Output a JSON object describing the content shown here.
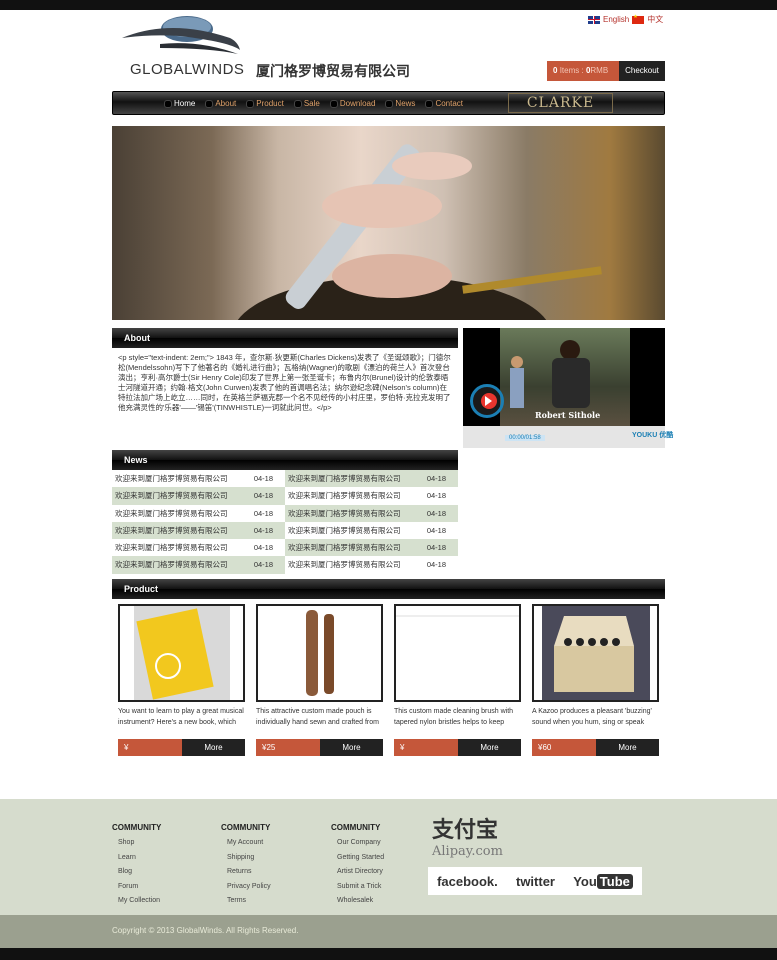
{
  "header": {
    "lang_en": "English",
    "lang_zh": "中文",
    "logo_text": "GLOBALWINDS",
    "company_name": "厦门格罗博贸易有限公司",
    "cart_count": "0",
    "cart_items_label": "Items :",
    "cart_total": "0",
    "cart_currency": "RMB",
    "checkout_label": "Checkout",
    "brand_badge": "CLARKE"
  },
  "nav": {
    "items": [
      {
        "label": "Home"
      },
      {
        "label": "About"
      },
      {
        "label": "Product"
      },
      {
        "label": "Sale"
      },
      {
        "label": "Download"
      },
      {
        "label": "News"
      },
      {
        "label": "Contact"
      }
    ]
  },
  "about": {
    "heading": "About",
    "text": "<p style=\"text-indent: 2em;\"> 1843 年，查尔斯·狄更斯(Charles Dickens)发表了《圣诞颂歌》；门德尔松(Mendelssohn)写下了他著名的《婚礼进行曲》；瓦格纳(Wagner)的歌剧《漂泊的荷兰人》首次登台演出；亨利·高尔爵士(Sir Henry Cole)印发了世界上第一张圣诞卡；布鲁内尔(Brunel)设计的伦敦泰晤士河隧道开通；约翰·格文(John Curwen)发表了他的首调唱名法；纳尔逊纪念碑(Nelson's column)在特拉法加广场上屹立……同时，在英格兰萨福克郡一个名不见经传的小村庄里，罗伯特·克拉克发明了他充满灵性的'乐器'——'锡笛'(TINWHISTLE)一词就此问世。</p>"
  },
  "video": {
    "caption": "Robert  Sithole",
    "time": "00:00/01:58",
    "provider": "YOUKU 优酷"
  },
  "news": {
    "heading": "News",
    "rows": [
      [
        {
          "title": "欢迎来到厦门格罗博贸易有限公司",
          "date": "04-18"
        },
        {
          "title": "欢迎来到厦门格罗博贸易有限公司",
          "date": "04-18"
        }
      ],
      [
        {
          "title": "欢迎来到厦门格罗博贸易有限公司",
          "date": "04-18"
        },
        {
          "title": "欢迎来到厦门格罗博贸易有限公司",
          "date": "04-18"
        }
      ],
      [
        {
          "title": "欢迎来到厦门格罗博贸易有限公司",
          "date": "04-18"
        },
        {
          "title": "欢迎来到厦门格罗博贸易有限公司",
          "date": "04-18"
        }
      ],
      [
        {
          "title": "欢迎来到厦门格罗博贸易有限公司",
          "date": "04-18"
        },
        {
          "title": "欢迎来到厦门格罗博贸易有限公司",
          "date": "04-18"
        }
      ],
      [
        {
          "title": "欢迎来到厦门格罗博贸易有限公司",
          "date": "04-18"
        },
        {
          "title": "欢迎来到厦门格罗博贸易有限公司",
          "date": "04-18"
        }
      ],
      [
        {
          "title": "欢迎来到厦门格罗博贸易有限公司",
          "date": "04-18"
        },
        {
          "title": "欢迎来到厦门格罗博贸易有限公司",
          "date": "04-18"
        }
      ]
    ]
  },
  "product": {
    "heading": "Product",
    "items": [
      {
        "desc": "You want to learn to play a great musical instrument? Here's a new book, which",
        "price": "¥",
        "more": "More"
      },
      {
        "desc": "This attractive custom made pouch is individually hand sewn and crafted from",
        "price": "¥25",
        "more": "More"
      },
      {
        "desc": "This custom made cleaning brush with tapered nylon bristles helps to keep",
        "price": "¥",
        "more": "More"
      },
      {
        "desc": "A Kazoo produces a pleasant 'buzzing' sound when you hum, sing or speak",
        "price": "¥60",
        "more": "More"
      }
    ]
  },
  "footer": {
    "cols": [
      {
        "heading": "COMMUNITY",
        "links": [
          "Shop",
          "Learn",
          "Blog",
          "Forum",
          "My Collection"
        ]
      },
      {
        "heading": "COMMUNITY",
        "links": [
          "My Account",
          "Shipping",
          "Returns",
          "Privacy Policy",
          "Terms"
        ]
      },
      {
        "heading": "COMMUNITY",
        "links": [
          "Our Company",
          "Getting Started",
          "Artist Directory",
          "Submit a Trick",
          "Wholesalek"
        ]
      }
    ],
    "alipay_cn": "支付宝",
    "alipay_en": "Alipay.com",
    "social": {
      "facebook": "facebook.",
      "twitter": "twitter",
      "youtube_you": "You",
      "youtube_tube": "Tube"
    },
    "copyright": "Copyright © 2013 GlobalWinds. All Rights Reserved."
  },
  "colors": {
    "accent": "#c5573a",
    "dark": "#222222",
    "footer_bg": "#d6dccd",
    "news_alt": "#d6e0cf"
  }
}
